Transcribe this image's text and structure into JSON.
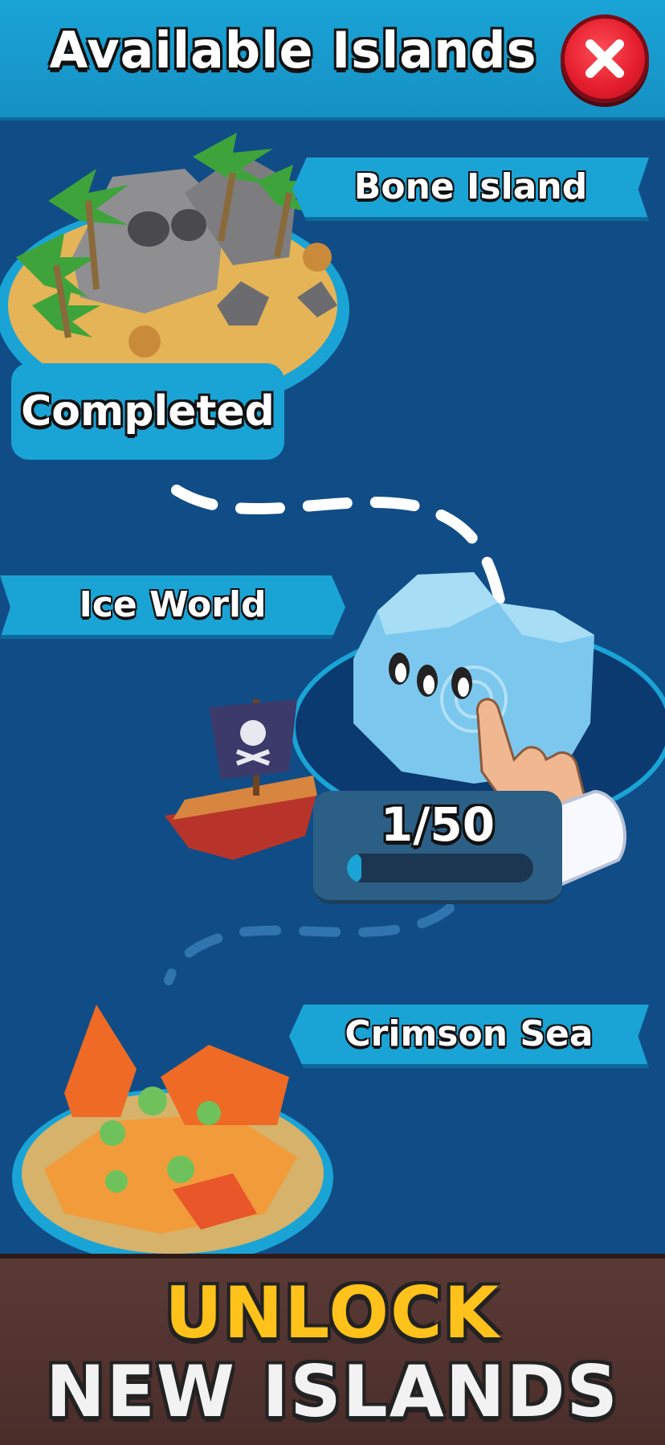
{
  "header": {
    "title": "Available Islands",
    "close_icon": "close-icon"
  },
  "islands": [
    {
      "name": "Bone Island",
      "status": "Completed"
    },
    {
      "name": "Ice World",
      "progress_label": "1/50",
      "progress_fraction": 0.02
    },
    {
      "name": "Crimson Sea"
    }
  ],
  "footer": {
    "line1": "UNLOCK",
    "line2": "NEW ISLANDS"
  },
  "colors": {
    "ocean": "#104d86",
    "banner": "#1aa4d6",
    "close_button": "#e31c2b",
    "footer_wood": "#4a2d2a",
    "footer_accent": "#ffc21a"
  }
}
